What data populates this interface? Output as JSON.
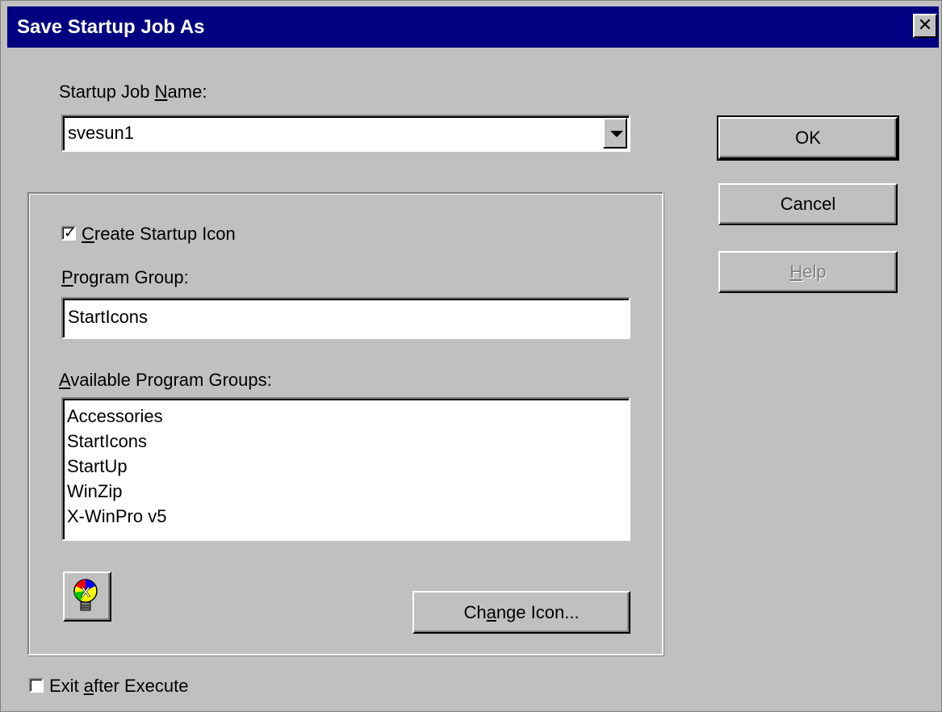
{
  "window": {
    "title": "Save Startup Job As",
    "close_label": "✕"
  },
  "job_name": {
    "label_pre": "Startup Job ",
    "label_accel": "N",
    "label_post": "ame:",
    "value": "svesun1"
  },
  "create_icon": {
    "checked": true,
    "label_accel": "C",
    "label_post": "reate Startup Icon"
  },
  "program_group": {
    "label_accel": "P",
    "label_post": "rogram Group:",
    "value": "StartIcons"
  },
  "available_groups": {
    "label_accel": "A",
    "label_post": "vailable Program Groups:",
    "items": [
      "Accessories",
      "StartIcons",
      "StartUp",
      "WinZip",
      "X-WinPro v5"
    ]
  },
  "change_icon": {
    "label_pre": "Ch",
    "label_accel": "a",
    "label_post": "nge Icon..."
  },
  "exit_after": {
    "checked": false,
    "label_pre": "Exit ",
    "label_accel": "a",
    "label_post": "fter Execute"
  },
  "buttons": {
    "ok": "OK",
    "cancel": "Cancel",
    "help_accel": "H",
    "help_post": "elp"
  },
  "icon": {
    "name": "x-win-lightbulb-icon",
    "letter": "X"
  },
  "colors": {
    "title_bar": "#000080",
    "dialog_bg": "#c0c0c0"
  }
}
